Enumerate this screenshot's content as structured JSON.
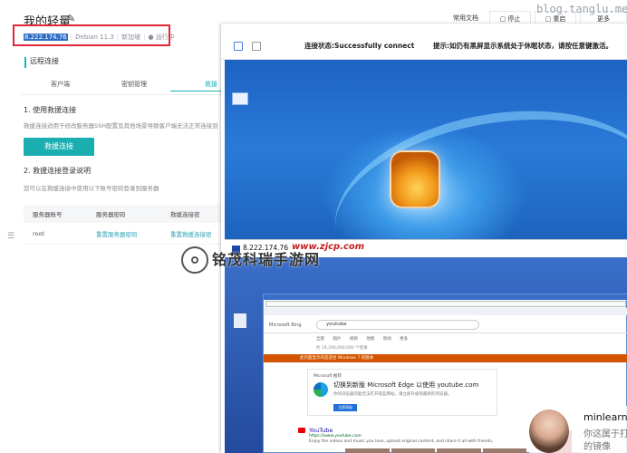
{
  "watermark": "blog.tanglu.me",
  "console": {
    "title": "我的轻量",
    "ip": "8.222.174.76",
    "os": "Debian 11.3",
    "region": "新加坡",
    "status": "运行中",
    "section": "远程连接",
    "tabs": [
      "客户端",
      "密钥管理",
      "救援"
    ],
    "step1": "1. 使用救援连接",
    "step1_desc": "救援连接适用于修改服务器SSH配置及其他场景导致客户端无法正常连接到",
    "rescue_button": "救援连接",
    "step2": "2. 救援连接登录说明",
    "step2_desc": "您可以在救援连接中使用以下账号密码登录到服务器",
    "table": {
      "headers": [
        "服务器账号",
        "服务器密码",
        "救援连接密"
      ],
      "rows": [
        [
          "root",
          "重置服务器密码",
          "重置救援连接密"
        ]
      ]
    }
  },
  "toolbar": {
    "docs": "常用文档",
    "stop": "停止",
    "restart": "重启",
    "more": "更多"
  },
  "remote": {
    "status": "连接状态:Successfully connect",
    "tip": "提示:如仍有黑屏显示系统处于休眠状态，请按任意键激活。",
    "taskbar_text": "8.222.174.76",
    "overlay_brand": "www.zjcp.com",
    "browser": {
      "bing": "Microsoft Bing",
      "query": "youtube",
      "nav": "全部 图片 视频 地图 新闻 更多",
      "count": "约 19,200,000,000 个结果",
      "banner": "此页面显示的是适合 Windows 7 的版本",
      "edge_source": "Microsoft 推荐",
      "edge_title": "切换到新版 Microsoft Edge 以使用 youtube.com",
      "edge_desc": "你的浏览器可能无法打开某些网站，请立即升级到最新的浏览器。",
      "edge_button": "立即获取",
      "yt_title": "YouTube",
      "yt_url": "https://www.youtube.com",
      "yt_desc": "Enjoy the videos and music you love, upload original content, and share it all with friends,",
      "yt_desc2": "family, and the world on YouTube."
    }
  },
  "watermark_center": "铭茂科瑞手游网",
  "ad": {
    "name": "minlearn",
    "line1": "你这属于打",
    "line2": "的镜像"
  }
}
